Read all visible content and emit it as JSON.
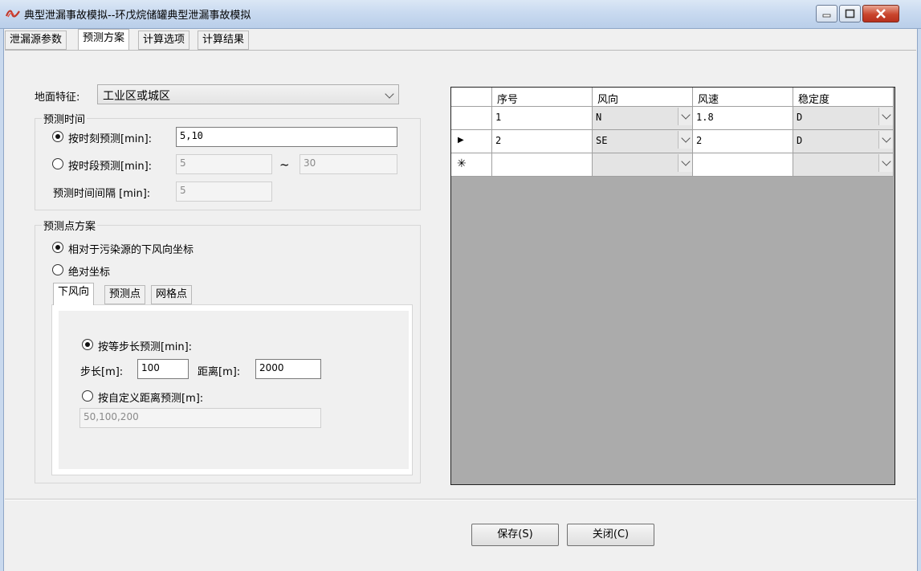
{
  "window": {
    "title": "典型泄漏事故模拟--环戊烷储罐典型泄漏事故模拟",
    "icon": "app-logo-icon"
  },
  "main_tabs": [
    "泄漏源参数",
    "预测方案",
    "计算选项",
    "计算结果"
  ],
  "active_main_tab": "预测方案",
  "form": {
    "ground_label": "地面特征:",
    "ground_value": "工业区或城区",
    "time_group_title": "预测时间",
    "by_moment_label": "按时刻预测[min]:",
    "by_moment_value": "5,10",
    "by_period_label": "按时段预测[min]:",
    "period_from": "5",
    "tilde": "~",
    "period_to": "30",
    "interval_label": "预测时间间隔 [min]:",
    "interval_value": "5",
    "point_group_title": "预测点方案",
    "relative_label": "相对于污染源的下风向坐标",
    "absolute_label": "绝对坐标"
  },
  "sub_tabs": [
    "下风向",
    "预测点",
    "网格点"
  ],
  "active_sub_tab": "下风向",
  "downwind": {
    "equal_step_label": "按等步长预测[min]:",
    "step_label": "步长[m]:",
    "step_value": "100",
    "distance_label": "距离[m]:",
    "distance_value": "2000",
    "custom_label": "按自定义距离预测[m]:",
    "custom_value": "50,100,200"
  },
  "grid": {
    "columns": [
      "序号",
      "风向",
      "风速",
      "稳定度"
    ],
    "rows": [
      {
        "indicator": "",
        "no": "1",
        "dir": "N",
        "speed": "1.8",
        "stability": "D"
      },
      {
        "indicator": "▶",
        "no": "2",
        "dir": "SE",
        "speed": "2",
        "stability": "D"
      },
      {
        "indicator": "✳",
        "no": "",
        "dir": "",
        "speed": "",
        "stability": ""
      }
    ]
  },
  "buttons": {
    "save": "保存(S)",
    "close": "关闭(C)"
  }
}
